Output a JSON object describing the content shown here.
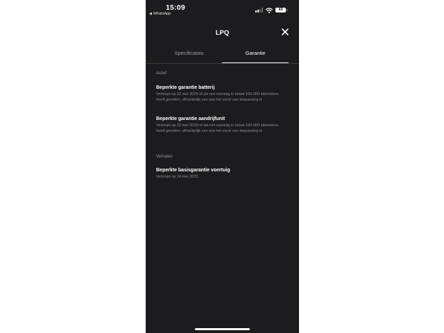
{
  "status_bar": {
    "time": "15:09",
    "back_app": "WhatsApp",
    "battery": "43"
  },
  "header": {
    "title": "LPQ",
    "close_icon": "close-icon"
  },
  "tabs": [
    {
      "label": "Specificaties",
      "active": false
    },
    {
      "label": "Garantie",
      "active": true
    }
  ],
  "sections": {
    "active": {
      "label": "Actief",
      "items": [
        {
          "title": "Beperkte garantie batterij",
          "description": "Verloopt op 22 mei 2029 of als het voertuig in totaal 160.000 kilometers heeft gereden, afhankelijk van wat het eerst van toepassing is"
        },
        {
          "title": "Beperkte garantie aandrijfunit",
          "description": "Verloopt op 22 mei 2029 of als het voertuig in totaal 160.000 kilometers heeft gereden, afhankelijk van wat het eerst van toepassing is"
        }
      ]
    },
    "expired": {
      "label": "Verlopen",
      "items": [
        {
          "title": "Beperkte basisgarantie voertuig",
          "description": "Verloopt op 24 mei 2025"
        }
      ]
    }
  },
  "colors": {
    "background": "#1c1c1e",
    "text_primary": "#ffffff",
    "text_secondary": "#8e8e93",
    "divider": "#3a3a3c"
  }
}
